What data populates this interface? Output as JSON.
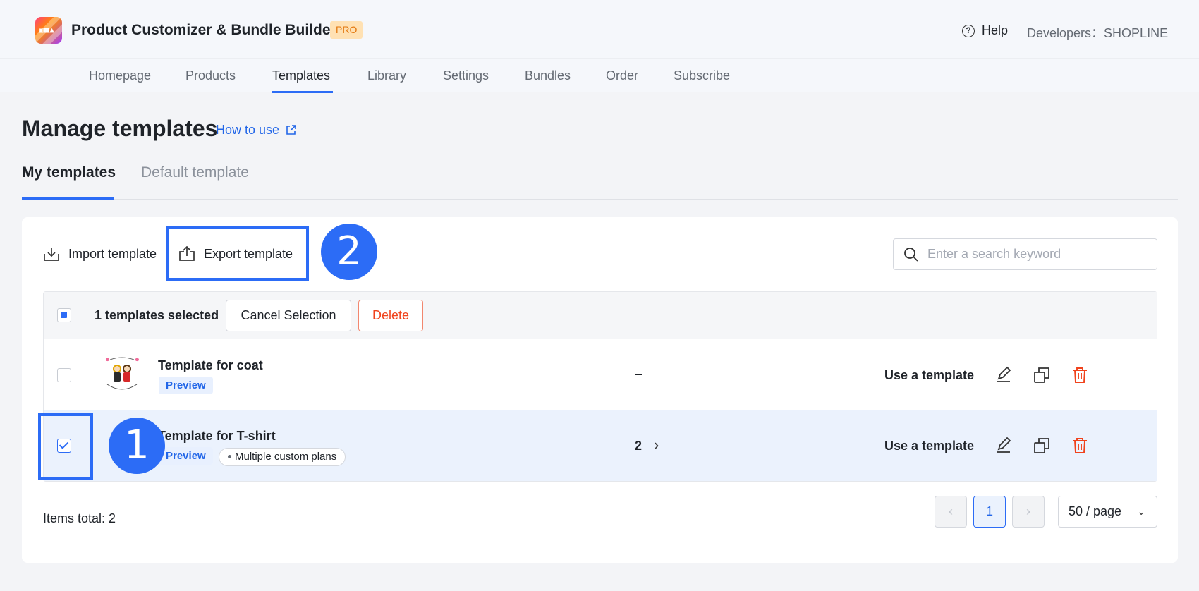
{
  "header": {
    "app_title": "Product Customizer & Bundle Builder",
    "badge": "PRO",
    "help_label": "Help",
    "developers_label": "Developers：SHOPLINE"
  },
  "nav": {
    "items": [
      "Homepage",
      "Products",
      "Templates",
      "Library",
      "Settings",
      "Bundles",
      "Order",
      "Subscribe"
    ],
    "active": "Templates"
  },
  "page": {
    "title": "Manage templates",
    "how_to_link": "How to use"
  },
  "tabs": {
    "my_templates": "My templates",
    "default_template": "Default template",
    "active": "My templates"
  },
  "toolbar": {
    "import_label": "Import template",
    "export_label": "Export template",
    "search_placeholder": "Enter a search keyword"
  },
  "annotations": {
    "step_1": "1",
    "step_2": "2"
  },
  "selection": {
    "selected_text": "1 templates selected",
    "cancel_label": "Cancel Selection",
    "delete_label": "Delete"
  },
  "rows": [
    {
      "name": "Template for coat",
      "preview_label": "Preview",
      "plans": "–",
      "checked": false,
      "use_label": "Use a template"
    },
    {
      "name": "Template for T-shirt",
      "preview_label": "Preview",
      "tag": "Multiple custom plans",
      "plans": "2",
      "checked": true,
      "use_label": "Use a template"
    }
  ],
  "footer": {
    "items_total": "Items total: 2",
    "current_page": "1",
    "per_page": "50 / page"
  },
  "colors": {
    "accent": "#2c6cf6",
    "link": "#2266e8",
    "danger": "#f0421c",
    "badge_bg": "#ffe1b3",
    "badge_text": "#e2750b"
  }
}
